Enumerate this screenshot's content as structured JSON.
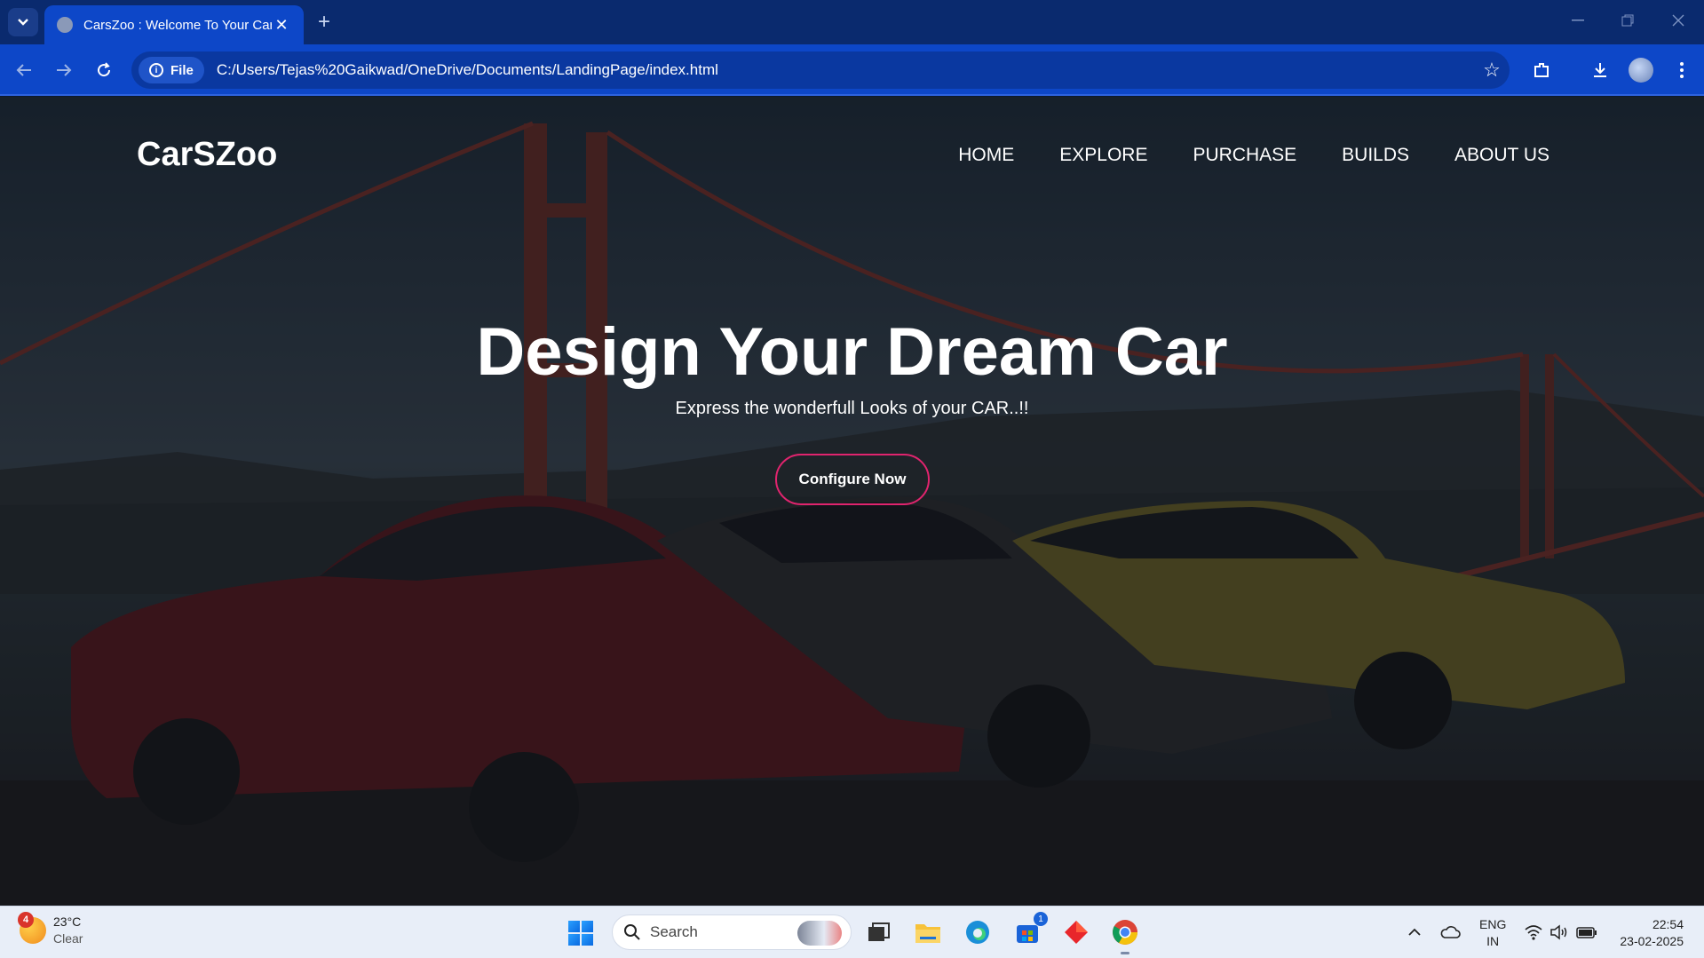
{
  "browser": {
    "tab_title": "CarsZoo : Welcome To Your Car",
    "tab_close": "✕",
    "new_tab": "+",
    "file_chip": "File",
    "url": "C:/Users/Tejas%20Gaikwad/OneDrive/Documents/LandingPage/index.html"
  },
  "page": {
    "brand": "CarSZoo",
    "nav": [
      "HOME",
      "EXPLORE",
      "PURCHASE",
      "BUILDS",
      "ABOUT US"
    ],
    "hero_title": "Design Your Dream Car",
    "hero_subtitle": "Express the wonderfull Looks of your CAR..!!",
    "cta_label": "Configure Now",
    "accent_color": "#e0246e"
  },
  "taskbar": {
    "weather_badge": "4",
    "temperature": "23°C",
    "condition": "Clear",
    "search_placeholder": "Search",
    "store_badge": "1",
    "lang_primary": "ENG",
    "lang_secondary": "IN",
    "time": "22:54",
    "date": "23-02-2025"
  },
  "icons": [
    "tab-list-icon",
    "favicon-icon",
    "close-icon",
    "plus-icon",
    "minimize-icon",
    "restore-icon",
    "window-close-icon",
    "back-icon",
    "forward-icon",
    "reload-icon",
    "info-icon",
    "star-icon",
    "extensions-icon",
    "download-icon",
    "avatar",
    "menu-icon",
    "weather-icon",
    "windows-start-icon",
    "search-icon",
    "task-view-icon",
    "file-explorer-icon",
    "edge-icon",
    "store-icon",
    "diamond-app-icon",
    "chrome-icon",
    "chevron-up-icon",
    "onedrive-cloud-icon",
    "wifi-icon",
    "volume-icon",
    "battery-icon"
  ]
}
